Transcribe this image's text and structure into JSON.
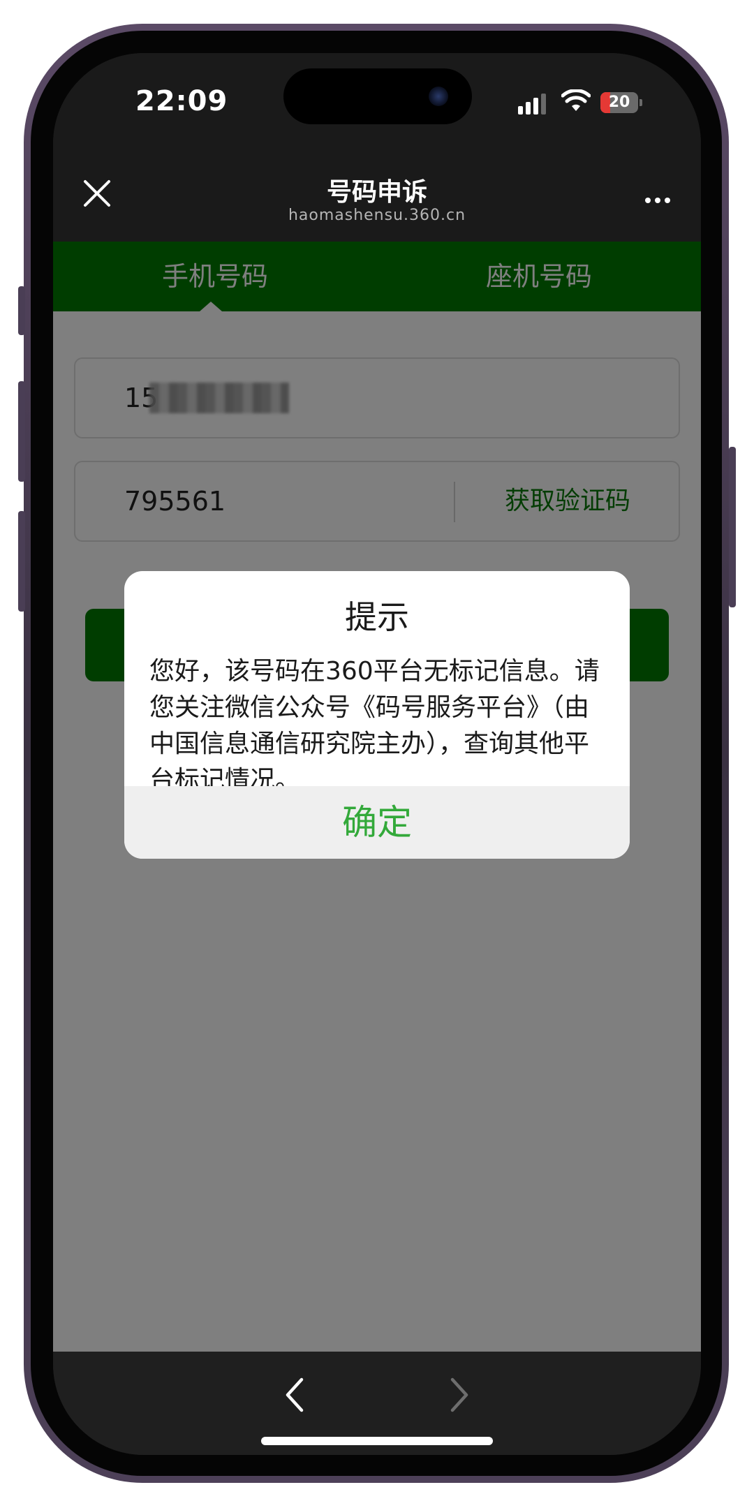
{
  "status_bar": {
    "time": "22:09",
    "battery_level": "20",
    "battery_color": "#e53935"
  },
  "header": {
    "close_icon": "close-icon",
    "title": "号码申诉",
    "url": "haomashensu.360.cn",
    "more_icon": "more-dots-icon"
  },
  "tabs": [
    {
      "label": "手机号码",
      "active": true
    },
    {
      "label": "座机号码",
      "active": false
    }
  ],
  "form": {
    "phone_value": "15",
    "code_value": "795561",
    "get_code_label": "获取验证码"
  },
  "dialog": {
    "title": "提示",
    "message": "您好，该号码在360平台无标记信息。请您关注微信公众号《码号服务平台》（由中国信息通信研究院主办），查询其他平台标记情况。",
    "confirm_label": "确定"
  },
  "toolbar": {
    "back_icon": "chevron-left-icon",
    "forward_icon": "chevron-right-icon"
  },
  "colors": {
    "brand_green": "#007a00",
    "confirm_green": "#33a93a"
  }
}
